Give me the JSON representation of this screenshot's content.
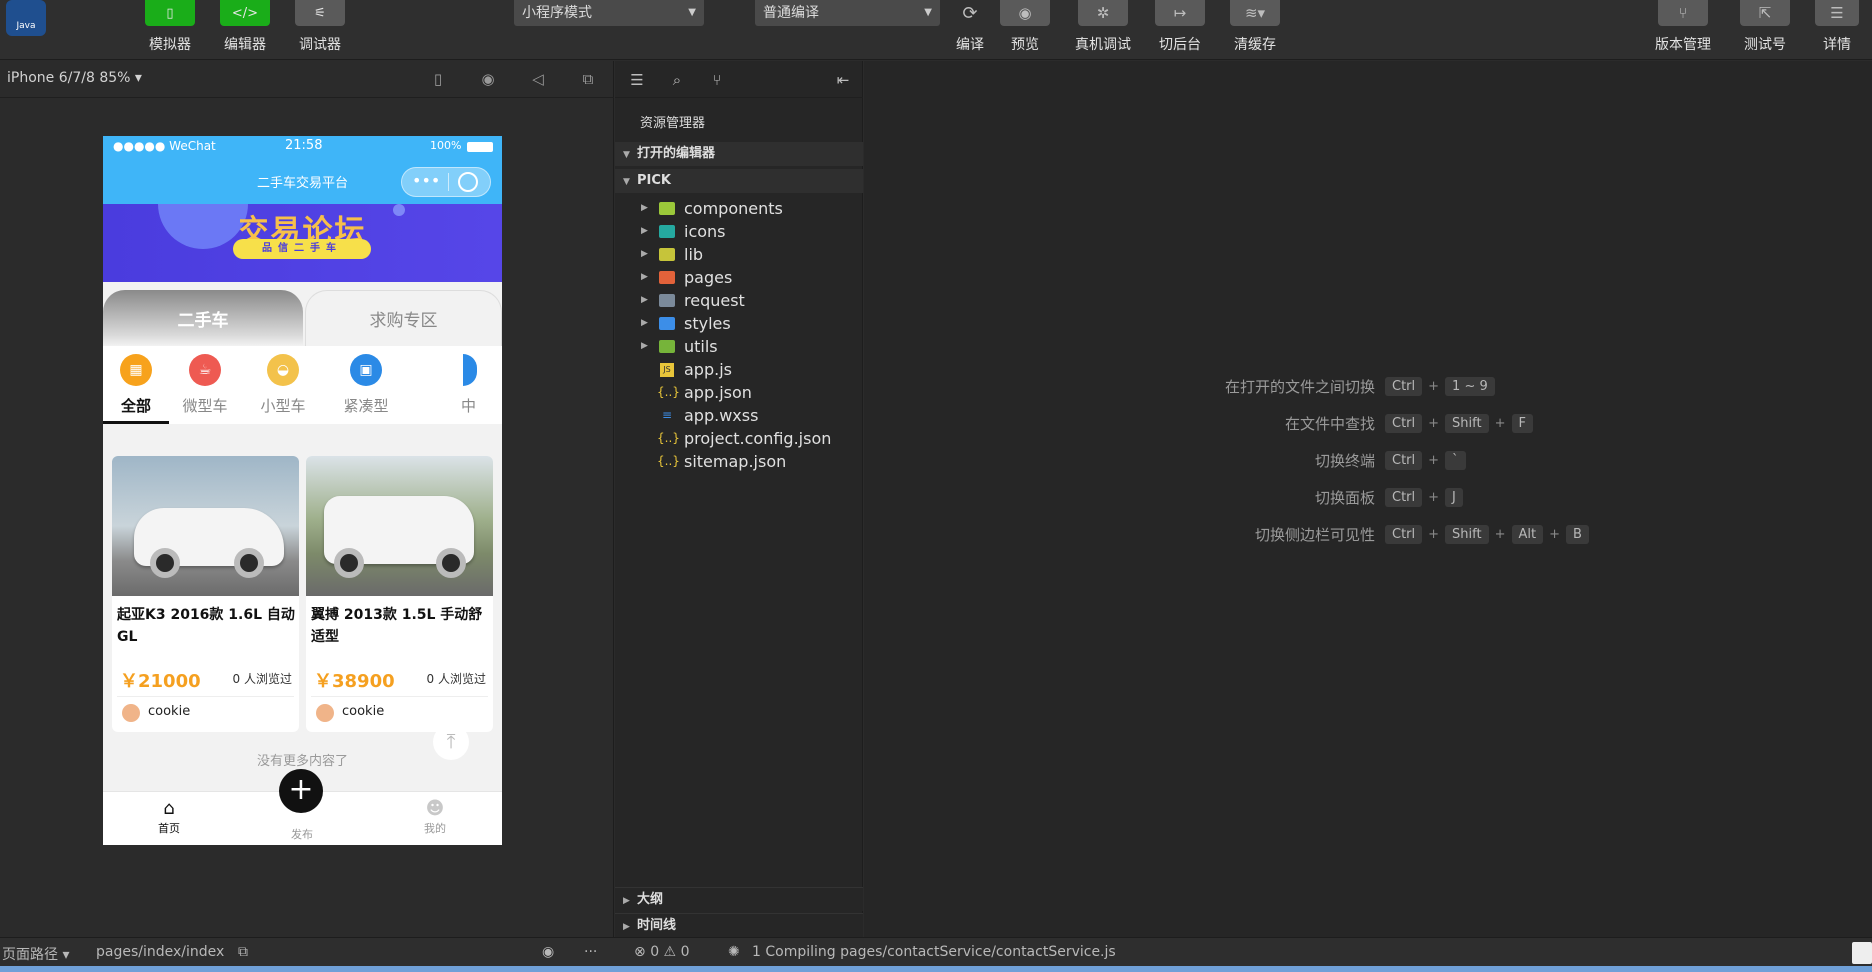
{
  "toolbar": {
    "logo_text": "Java",
    "simulator": "模拟器",
    "editor": "编辑器",
    "debugger": "调试器",
    "mode_select": "小程序模式",
    "compile_select": "普通编译",
    "compile": "编译",
    "preview": "预览",
    "remote_debug": "真机调试",
    "background": "切后台",
    "clear_cache": "清缓存",
    "version": "版本管理",
    "test": "测试号",
    "details": "详情"
  },
  "simulator": {
    "device": "iPhone 6/7/8 85%",
    "status": {
      "carrier": "●●●●● WeChat",
      "time": "21:58",
      "battery": "100%"
    },
    "nav_title": "二手车交易平台",
    "banner_title": "交易论坛",
    "banner_sub": "品信二手车",
    "tabs": [
      "二手车",
      "求购专区"
    ],
    "categories": [
      {
        "label": "全部",
        "color": "#f7a21c"
      },
      {
        "label": "微型车",
        "color": "#ee5a52"
      },
      {
        "label": "小型车",
        "color": "#f3c24b"
      },
      {
        "label": "紧凑型",
        "color": "#2b8ae6"
      },
      {
        "label": "中",
        "color": "#2b8ae6"
      }
    ],
    "cards": [
      {
        "title": "起亚K3 2016款 1.6L 自动GL",
        "price": "￥21000",
        "views": "0 人浏览过",
        "user": "cookie"
      },
      {
        "title": "翼搏 2013款 1.5L 手动舒适型",
        "price": "￥38900",
        "views": "0 人浏览过",
        "user": "cookie"
      }
    ],
    "no_more": "没有更多内容了",
    "tabbar": {
      "home": "首页",
      "publish": "发布",
      "mine": "我的"
    }
  },
  "explorer": {
    "title": "资源管理器",
    "open_editors": "打开的编辑器",
    "project": "PICK",
    "items": [
      {
        "name": "components",
        "type": "folder",
        "color": "#9bc83a"
      },
      {
        "name": "icons",
        "type": "folder",
        "color": "#25a9a0"
      },
      {
        "name": "lib",
        "type": "folder",
        "color": "#c6c43a"
      },
      {
        "name": "pages",
        "type": "folder",
        "color": "#e2623a"
      },
      {
        "name": "request",
        "type": "folder",
        "color": "#7b8a9a"
      },
      {
        "name": "styles",
        "type": "folder",
        "color": "#3c8ee8"
      },
      {
        "name": "utils",
        "type": "folder",
        "color": "#76b43a"
      },
      {
        "name": "app.js",
        "type": "js"
      },
      {
        "name": "app.json",
        "type": "json"
      },
      {
        "name": "app.wxss",
        "type": "css"
      },
      {
        "name": "project.config.json",
        "type": "json"
      },
      {
        "name": "sitemap.json",
        "type": "json"
      }
    ],
    "outline": "大纲",
    "timeline": "时间线"
  },
  "editor": {
    "shortcuts": [
      {
        "label": "在打开的文件之间切换",
        "keys": [
          "Ctrl",
          "1 ~ 9"
        ]
      },
      {
        "label": "在文件中查找",
        "keys": [
          "Ctrl",
          "Shift",
          "F"
        ]
      },
      {
        "label": "切换终端",
        "keys": [
          "Ctrl",
          "`"
        ]
      },
      {
        "label": "切换面板",
        "keys": [
          "Ctrl",
          "J"
        ]
      },
      {
        "label": "切换侧边栏可见性",
        "keys": [
          "Ctrl",
          "Shift",
          "Alt",
          "B"
        ]
      }
    ]
  },
  "statusbar": {
    "page_path_label": "页面路径",
    "page_path": "pages/index/index",
    "errors": "0",
    "warnings": "0",
    "compiling": "1 Compiling pages/contactService/contactService.js"
  }
}
